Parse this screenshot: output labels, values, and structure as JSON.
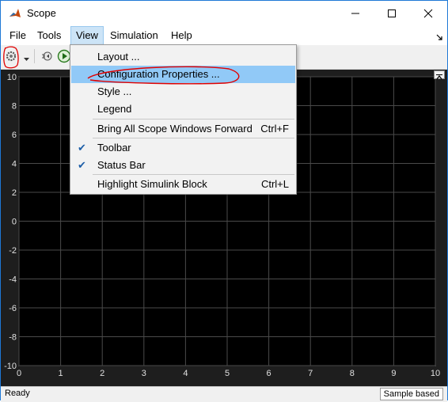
{
  "window": {
    "title": "Scope",
    "app_icon": "matlab-icon"
  },
  "menubar": {
    "items": [
      {
        "label": "File"
      },
      {
        "label": "Tools"
      },
      {
        "label": "View"
      },
      {
        "label": "Simulation"
      },
      {
        "label": "Help"
      }
    ]
  },
  "view_menu": {
    "items": [
      {
        "label": "Layout ...",
        "shortcut": ""
      },
      {
        "label": "Configuration Properties ...",
        "shortcut": ""
      },
      {
        "label": "Style ...",
        "shortcut": ""
      },
      {
        "label": "Legend",
        "shortcut": ""
      },
      {
        "label": "Bring All Scope Windows Forward",
        "shortcut": "Ctrl+F"
      },
      {
        "label": "Toolbar",
        "shortcut": "",
        "checked": true
      },
      {
        "label": "Status Bar",
        "shortcut": "",
        "checked": true
      },
      {
        "label": "Highlight Simulink Block",
        "shortcut": "Ctrl+L"
      }
    ],
    "check_glyph": "✔"
  },
  "plot": {
    "x_ticks": [
      "0",
      "1",
      "2",
      "3",
      "4",
      "5",
      "6",
      "7",
      "8",
      "9",
      "10"
    ],
    "y_ticks": [
      "10",
      "8",
      "6",
      "4",
      "2",
      "0",
      "-2",
      "-4",
      "-6",
      "-8",
      "-10"
    ],
    "xlim": [
      0,
      10
    ],
    "ylim": [
      -10,
      10
    ]
  },
  "status": {
    "left": "Ready",
    "right": "Sample based"
  },
  "colors": {
    "accent": "#1e78d6",
    "menu_highlight": "#91c9f7",
    "plot_bg": "#000000",
    "annotation": "#e00000"
  }
}
